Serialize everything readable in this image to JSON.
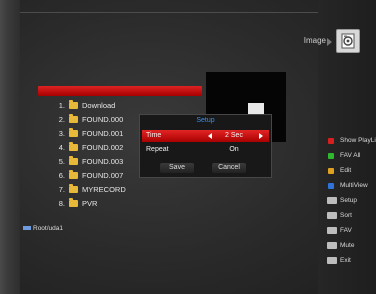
{
  "header": {
    "title": "Image"
  },
  "file_browser": {
    "path": "",
    "items": [
      {
        "num": "1.",
        "name": "Download"
      },
      {
        "num": "2.",
        "name": "FOUND.000"
      },
      {
        "num": "3.",
        "name": "FOUND.001"
      },
      {
        "num": "4.",
        "name": "FOUND.002"
      },
      {
        "num": "5.",
        "name": "FOUND.003"
      },
      {
        "num": "6.",
        "name": "FOUND.007"
      },
      {
        "num": "7.",
        "name": "MYRECORD"
      },
      {
        "num": "8.",
        "name": "PVR"
      }
    ],
    "device_label": "Root/uda1"
  },
  "setup_dialog": {
    "title": "Setup",
    "options": [
      {
        "label": "Time",
        "value": "2 Sec"
      },
      {
        "label": "Repeat",
        "value": "On"
      }
    ],
    "save_label": "Save",
    "cancel_label": "Cancel"
  },
  "legend": {
    "items": [
      {
        "label": "Show PlayList",
        "color": "#d81f1f",
        "kind": "color-key"
      },
      {
        "label": "FAV All",
        "color": "#2eb82e",
        "kind": "color-key"
      },
      {
        "label": "Edit",
        "color": "#e0a020",
        "kind": "color-key"
      },
      {
        "label": "MultiView",
        "color": "#2f73d8",
        "kind": "color-key"
      },
      {
        "label": "Setup",
        "color": "#cfcfcf",
        "kind": "remote-key"
      },
      {
        "label": "Sort",
        "color": "#cfcfcf",
        "kind": "remote-key"
      },
      {
        "label": "FAV",
        "color": "#cfcfcf",
        "kind": "remote-key"
      },
      {
        "label": "Mute",
        "color": "#cfcfcf",
        "kind": "remote-key"
      },
      {
        "label": "Exit",
        "color": "#cfcfcf",
        "kind": "remote-key"
      }
    ]
  },
  "colors": {
    "accent_red": "#c80d0d",
    "title_blue": "#3b8fe8",
    "folder_yellow": "#e8b838"
  }
}
